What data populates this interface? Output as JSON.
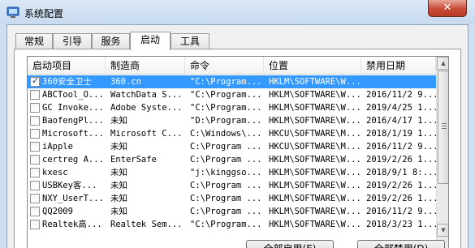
{
  "window": {
    "title": "系统配置",
    "close_label": "✕"
  },
  "tabs": [
    {
      "label": "常规"
    },
    {
      "label": "引导"
    },
    {
      "label": "服务"
    },
    {
      "label": "启动",
      "active": true
    },
    {
      "label": "工具"
    }
  ],
  "table": {
    "columns": [
      "启动项目",
      "制造商",
      "命令",
      "位置",
      "禁用日期"
    ],
    "rows": [
      {
        "checked": true,
        "item": "360安全卫士",
        "maker": "360.cn",
        "command": "\"C:\\Program...",
        "location": "HKLM\\SOFTWARE\\W...",
        "date": ""
      },
      {
        "checked": false,
        "item": "ABCTool_O...",
        "maker": "WatchData S...",
        "command": "\"C:\\Program...",
        "location": "HKLM\\SOFTWARE\\W...",
        "date": "2016/11/2 9..."
      },
      {
        "checked": false,
        "item": "GC Invoke...",
        "maker": "Adobe Syste...",
        "command": "\"C:\\Program...",
        "location": "HKLM\\SOFTWARE\\W...",
        "date": "2019/4/25 1..."
      },
      {
        "checked": false,
        "item": "BaofengPl...",
        "maker": "未知",
        "command": "\"D:\\Program...",
        "location": "HKLM\\SOFTWARE\\W...",
        "date": "2016/4/17 1..."
      },
      {
        "checked": false,
        "item": "Microsoft...",
        "maker": "Microsoft C...",
        "command": "C:\\Windows\\...",
        "location": "HKCU\\SOFTWARE\\M...",
        "date": "2018/1/19 1..."
      },
      {
        "checked": false,
        "item": "iApple",
        "maker": "未知",
        "command": "C:\\Program ...",
        "location": "HKCU\\SOFTWARE\\M...",
        "date": "2016/11/2 9..."
      },
      {
        "checked": false,
        "item": "certreg A...",
        "maker": "EnterSafe",
        "command": "C:\\Program ...",
        "location": "HKLM\\SOFTWARE\\W...",
        "date": "2019/2/26 1..."
      },
      {
        "checked": false,
        "item": "kxesc",
        "maker": "未知",
        "command": "\"j:\\kinggso...",
        "location": "HKLM\\SOFTWARE\\W...",
        "date": "2018/9/1 8:..."
      },
      {
        "checked": false,
        "item": "USBKey客...",
        "maker": "未知",
        "command": "C:\\Program ...",
        "location": "HKLM\\SOFTWARE\\W...",
        "date": "2019/2/26 1..."
      },
      {
        "checked": false,
        "item": "NXY_UserT...",
        "maker": "未知",
        "command": "C:\\Program ...",
        "location": "HKLM\\SOFTWARE\\W...",
        "date": "2019/2/26 1..."
      },
      {
        "checked": false,
        "item": "QQ2009",
        "maker": "未知",
        "command": "C:\\Program ...",
        "location": "HKLM\\SOFTWARE\\W...",
        "date": "2016/11/2 9..."
      },
      {
        "checked": false,
        "item": "Realtek高...",
        "maker": "Realtek Sem...",
        "command": "\"C:\\Program...",
        "location": "HKLM\\SOFTWARE\\W...",
        "date": "2018/3/23 1..."
      }
    ]
  },
  "buttons": {
    "enable_all": "全部启用(E)",
    "disable_all": "全部禁用(D)"
  }
}
